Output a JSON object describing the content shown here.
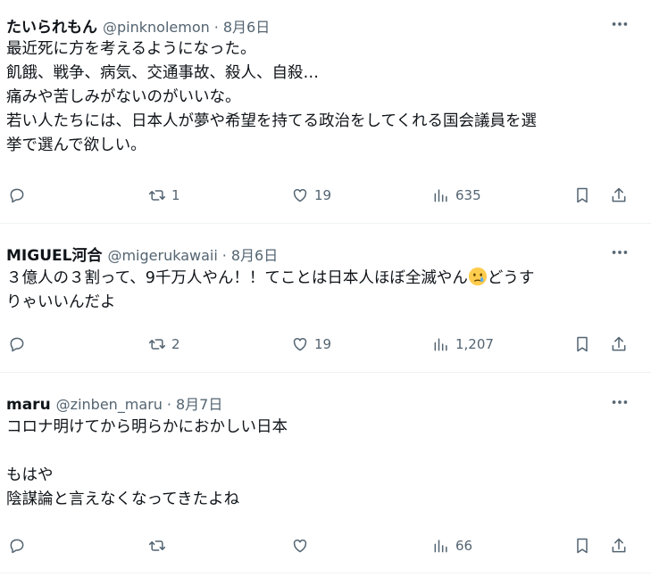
{
  "tweets": [
    {
      "name": "たいられもん",
      "handle": "@pinknolemon",
      "dot": "·",
      "date": "8月6日",
      "text": "最近死に方を考えるようになった。\n飢餓、戦争、病気、交通事故、殺人、自殺…\n痛みや苦しみがないのがいいな。\n若い人たちには、日本人が夢や希望を持てる政治をしてくれる国会議員を選\n挙で選んで欲しい。",
      "replies": "",
      "reposts": "1",
      "likes": "19",
      "views": "635"
    },
    {
      "name": "MIGUEL河合",
      "handle": "@migerukawaii",
      "dot": "·",
      "date": "8月6日",
      "text_before_emoji": "３億人の３割って、9千万人やん！！てことは日本人ほぼ全滅やん",
      "emoji": "crying-face-emoji",
      "text_after_emoji": "どうす\nりゃいいんだよ",
      "replies": "",
      "reposts": "2",
      "likes": "19",
      "views": "1,207"
    },
    {
      "name": "maru",
      "handle": "@zinben_maru",
      "dot": "·",
      "date": "8月7日",
      "text": "コロナ明けてから明らかにおかしい日本\n\nもはや\n陰謀論と言えなくなってきたよね",
      "replies": "",
      "reposts": "",
      "likes": "",
      "views": "66"
    }
  ],
  "icons": {
    "more": "more-horizontal-icon",
    "reply": "reply-icon",
    "repost": "repost-icon",
    "like": "like-icon",
    "views": "views-icon",
    "bookmark": "bookmark-icon",
    "share": "share-icon"
  },
  "colors": {
    "text": "#0f1419",
    "secondary": "#536471",
    "divider": "#eff3f4",
    "background": "#ffffff"
  }
}
